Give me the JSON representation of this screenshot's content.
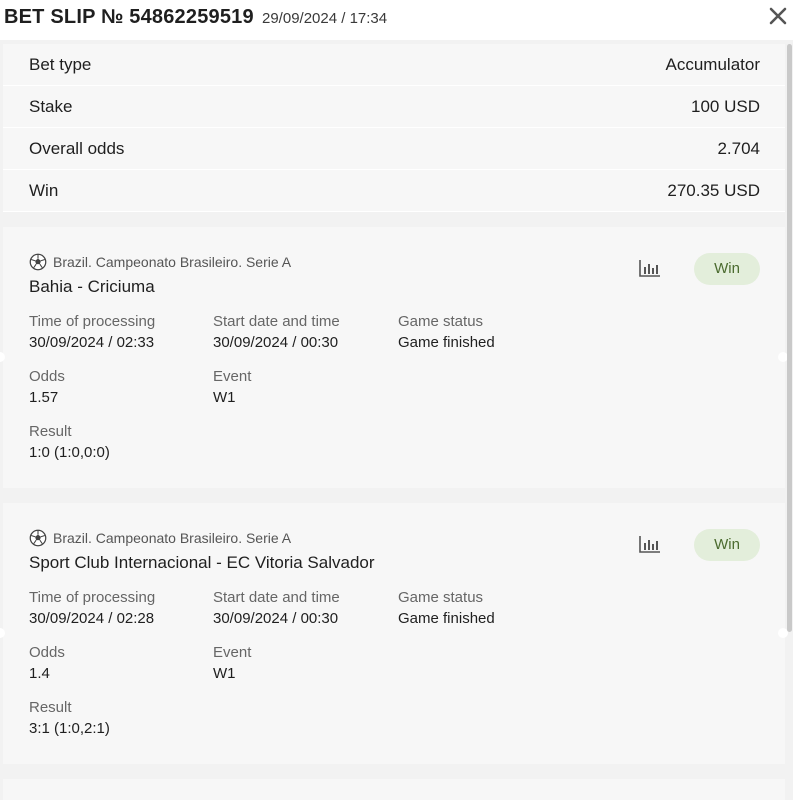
{
  "header": {
    "title": "BET SLIP № 54862259519",
    "datetime": "29/09/2024 / 17:34"
  },
  "summary": {
    "rows": [
      {
        "label": "Bet type",
        "value": "Accumulator"
      },
      {
        "label": "Stake",
        "value": "100 USD"
      },
      {
        "label": "Overall odds",
        "value": "2.704"
      },
      {
        "label": "Win",
        "value": "270.35 USD"
      }
    ]
  },
  "labels": {
    "time_of_processing": "Time of processing",
    "start_date_time": "Start date and time",
    "game_status": "Game status",
    "odds": "Odds",
    "event": "Event",
    "result": "Result"
  },
  "bets": [
    {
      "league": "Brazil. Campeonato Brasileiro. Serie A",
      "match": "Bahia - Criciuma",
      "status_badge": "Win",
      "time_of_processing": "30/09/2024 / 02:33",
      "start_date_time": "30/09/2024 / 00:30",
      "game_status": "Game finished",
      "odds": "1.57",
      "event": "W1",
      "result": "1:0 (1:0,0:0)"
    },
    {
      "league": "Brazil. Campeonato Brasileiro. Serie A",
      "match": "Sport Club Internacional - EC Vitoria Salvador",
      "status_badge": "Win",
      "time_of_processing": "30/09/2024 / 02:28",
      "start_date_time": "30/09/2024 / 00:30",
      "game_status": "Game finished",
      "odds": "1.4",
      "event": "W1",
      "result": "3:1 (1:0,2:1)"
    }
  ],
  "icons": {
    "close": "close-icon",
    "sport": "soccer-ball-icon",
    "stats": "statistics-icon"
  },
  "colors": {
    "badge_bg": "#e3eedb",
    "badge_text": "#4b6b2f",
    "card_bg": "#f7f7f7",
    "page_bg": "#f2f2f2"
  }
}
